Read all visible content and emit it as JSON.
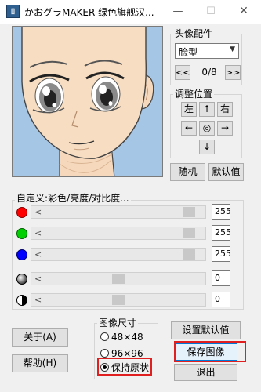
{
  "window": {
    "icon_text": "ﾛ",
    "title": "かおグラMAKER 绿色旗舰汉..."
  },
  "titlebar": {
    "minimize": "—",
    "maximize": "☐",
    "close": "✕"
  },
  "parts": {
    "title": "头像配件",
    "selected": "脸型",
    "counter": "0/8",
    "prev": "<<",
    "next": ">>"
  },
  "position": {
    "title": "调整位置",
    "left": "左",
    "up": "↑",
    "right": "右",
    "move_left": "←",
    "center": "◎",
    "move_right": "→",
    "down": "↓"
  },
  "buttons": {
    "random": "随机",
    "default": "默认值",
    "about": "关于(A)",
    "help": "帮助(H)",
    "set_default": "设置默认值",
    "save_image": "保存图像",
    "exit": "退出"
  },
  "adjust": {
    "title": "自定义:彩色/亮度/对比度...",
    "sliders": [
      {
        "label": "red",
        "value": "255",
        "color": "#ff0000",
        "level": 1.0
      },
      {
        "label": "green",
        "value": "255",
        "color": "#00d000",
        "level": 1.0
      },
      {
        "label": "blue",
        "value": "255",
        "color": "#0000ff",
        "level": 1.0
      },
      {
        "label": "brightness",
        "value": "0",
        "level": 0.5
      },
      {
        "label": "contrast",
        "value": "0",
        "level": 0.5
      }
    ]
  },
  "image_size": {
    "title": "图像尺寸",
    "options": [
      "48×48",
      "96×96",
      "保持原状"
    ],
    "selected_index": 2
  },
  "colors": {
    "highlight": "#e02020",
    "window_bg": "#f0f0f0"
  }
}
